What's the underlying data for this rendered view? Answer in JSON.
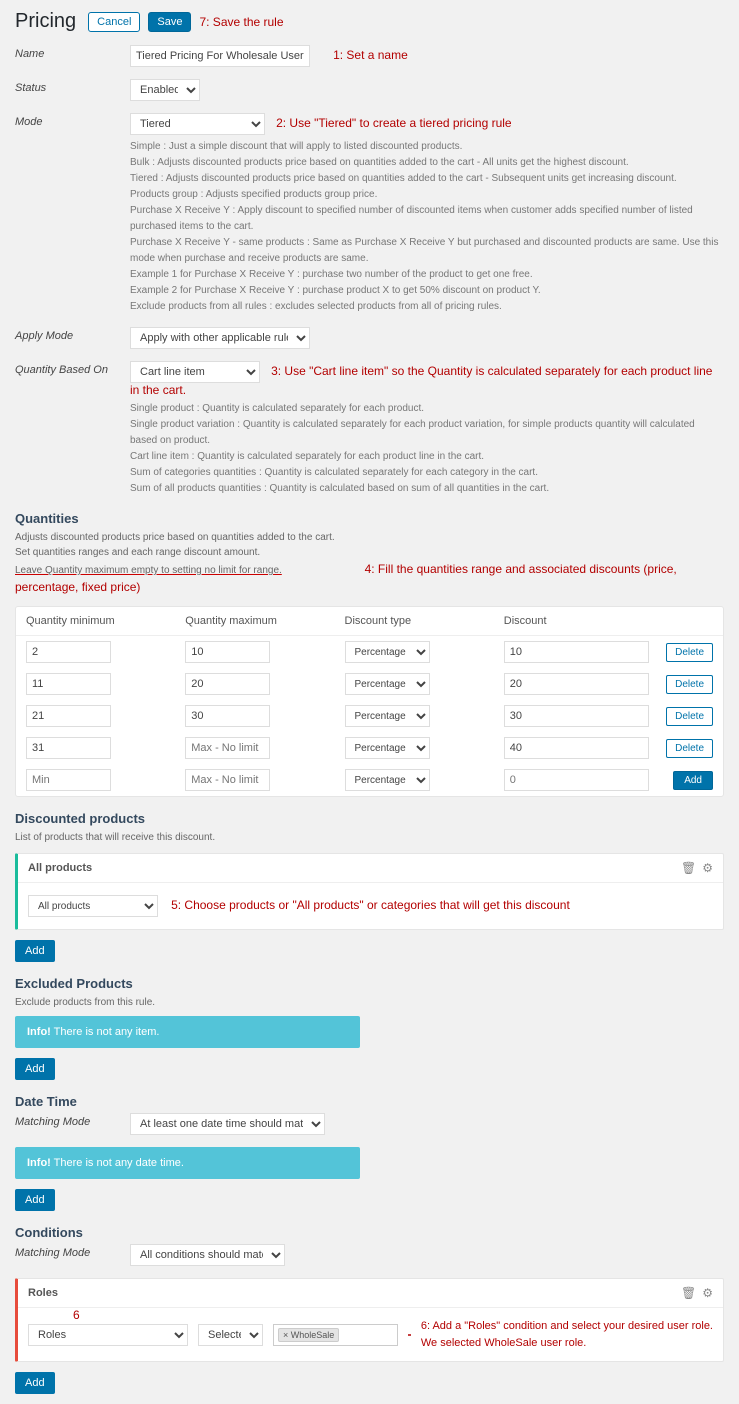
{
  "header": {
    "title": "Pricing",
    "cancel": "Cancel",
    "save": "Save",
    "anno": "7: Save the rule"
  },
  "name": {
    "label": "Name",
    "value": "Tiered Pricing For Wholesale User Role",
    "anno": "1: Set a name"
  },
  "status": {
    "label": "Status",
    "value": "Enabled"
  },
  "mode": {
    "label": "Mode",
    "value": "Tiered",
    "anno": "2: Use \"Tiered\" to create a tiered pricing rule",
    "help0": "Simple : Just a simple discount that will apply to listed discounted products.",
    "help1": "Bulk : Adjusts discounted products price based on quantities added to the cart - All units get the highest discount.",
    "help2": "Tiered : Adjusts discounted products price based on quantities added to the cart - Subsequent units get increasing discount.",
    "help3": "Products group : Adjusts specified products group price.",
    "help4": "Purchase X Receive Y : Apply discount to specified number of discounted items when customer adds specified number of listed purchased items to the cart.",
    "help5": "Purchase X Receive Y - same products : Same as Purchase X Receive Y but purchased and discounted products are same. Use this mode when purchase and receive products are same.",
    "help6": "Example 1 for Purchase X Receive Y : purchase two number of the product to get one free.",
    "help7": "Example 2 for Purchase X Receive Y : purchase product X to get 50% discount on product Y.",
    "help8": "Exclude products from all rules : excludes selected products from all of pricing rules."
  },
  "applyMode": {
    "label": "Apply Mode",
    "value": "Apply with other applicable rules"
  },
  "qbo": {
    "label": "Quantity Based On",
    "value": "Cart line item",
    "anno": "3: Use \"Cart line item\" so the Quantity is calculated separately for each product line in the cart.",
    "help0": "Single product : Quantity is calculated separately for each product.",
    "help1": "Single product variation : Quantity is calculated separately for each product variation, for simple products quantity will calculated based on product.",
    "help2": "Cart line item : Quantity is calculated separately for each product line in the cart.",
    "help3": "Sum of categories quantities : Quantity is calculated separately for each category in the cart.",
    "help4": "Sum of all products quantities : Quantity is calculated based on sum of all quantities in the cart."
  },
  "quantities": {
    "heading": "Quantities",
    "help0": "Adjusts discounted products price based on quantities added to the cart.",
    "help1": "Set quantities ranges and each range discount amount.",
    "help2": "Leave Quantity maximum empty to setting no limit for range.",
    "anno": "4: Fill the quantities range and associated discounts (price, percentage, fixed price)",
    "colMin": "Quantity minimum",
    "colMax": "Quantity maximum",
    "colType": "Discount type",
    "colDisc": "Discount",
    "rows": [
      {
        "min": "2",
        "max": "10",
        "type": "Percentage discount",
        "disc": "10"
      },
      {
        "min": "11",
        "max": "20",
        "type": "Percentage discount",
        "disc": "20"
      },
      {
        "min": "21",
        "max": "30",
        "type": "Percentage discount",
        "disc": "30"
      },
      {
        "min": "31",
        "max": "",
        "type": "Percentage discount",
        "disc": "40"
      }
    ],
    "maxPlaceholder": "Max - No limit",
    "minPlaceholder": "Min",
    "discPlaceholder": "0",
    "newType": "Percentage discount",
    "delete": "Delete",
    "add": "Add"
  },
  "discounted": {
    "heading": "Discounted products",
    "help": "List of products that will receive this discount.",
    "panelTitle": "All products",
    "select": "All products",
    "anno": "5: Choose products or \"All products\" or categories that will get this discount",
    "add": "Add"
  },
  "excluded": {
    "heading": "Excluded Products",
    "help": "Exclude products from this rule.",
    "infoLabel": "Info!",
    "infoText": " There is not any item.",
    "add": "Add"
  },
  "datetime": {
    "heading": "Date Time",
    "matchLabel": "Matching Mode",
    "matchValue": "At least one date time should match",
    "infoLabel": "Info!",
    "infoText": " There is not any date time.",
    "add": "Add"
  },
  "conditions": {
    "heading": "Conditions",
    "matchLabel": "Matching Mode",
    "matchValue": "All conditions should match",
    "panelTitle": "Roles",
    "six": "6",
    "select1": "Roles",
    "select2": "Selected",
    "tag": "× WholeSale",
    "anno1": "6: Add a \"Roles\" condition and select your desired user role.",
    "anno2": "We selected WholeSale user role.",
    "add": "Add"
  }
}
